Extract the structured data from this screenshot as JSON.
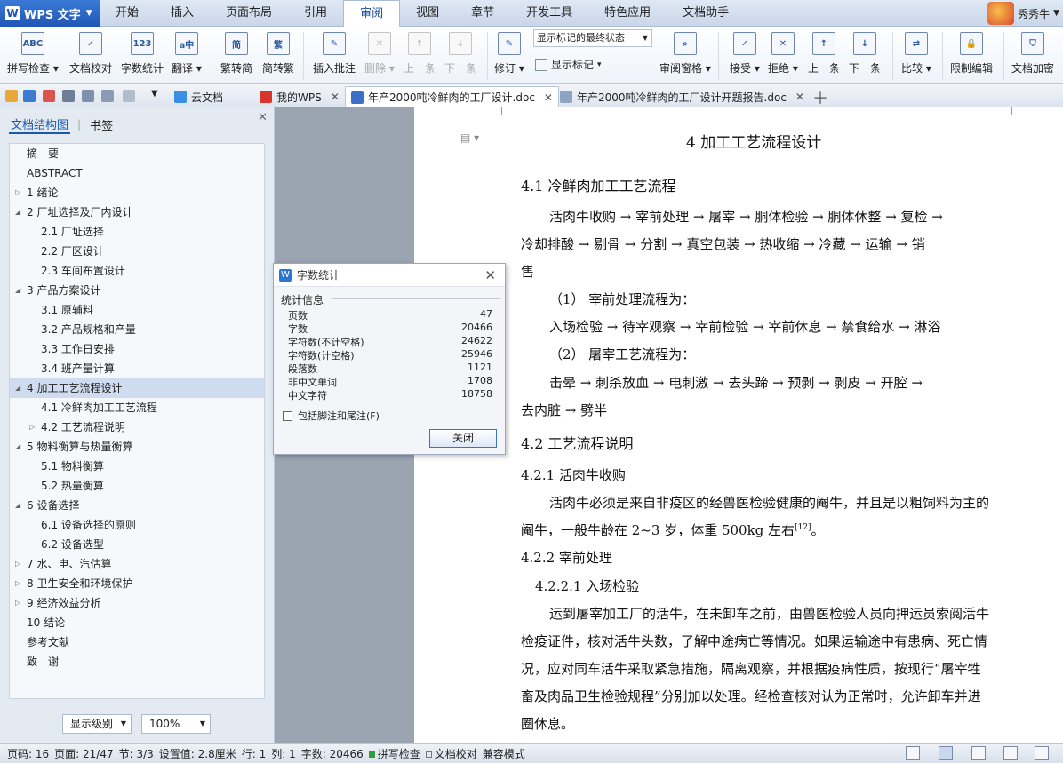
{
  "app": {
    "title": "WPS 文字"
  },
  "menu": [
    "开始",
    "插入",
    "页面布局",
    "引用",
    "审阅",
    "视图",
    "章节",
    "开发工具",
    "特色应用",
    "文档助手"
  ],
  "active_menu": "审阅",
  "user": {
    "name": "秀秀牛"
  },
  "ribbon": {
    "spell": "拼写检查",
    "doccheck": "文档校对",
    "wordcount": "字数统计",
    "translate": "翻译",
    "t2s": "繁转简",
    "s2t": "简转繁",
    "addcomment": "插入批注",
    "delete": "删除",
    "prev": "上一条",
    "next": "下一条",
    "revise": "修订",
    "markup_select": "显示标记的最终状态",
    "showmarks": "显示标记",
    "reviewpane": "审阅窗格",
    "accept": "接受",
    "reject": "拒绝",
    "prev2": "上一条",
    "next2": "下一条",
    "compare": "比较",
    "restrict": "限制编辑",
    "encrypt": "文档加密"
  },
  "tabs": [
    {
      "label": "云文档"
    },
    {
      "label": "我的WPS"
    },
    {
      "label": "年产2000吨冷鲜肉的工厂设计.doc"
    },
    {
      "label": "年产2000吨冷鲜肉的工厂设计开题报告.doc"
    }
  ],
  "panel": {
    "tab1": "文档结构图",
    "tab2": "书签",
    "level": "显示级别",
    "zoom": "100%"
  },
  "outline": [
    {
      "text": "摘　要",
      "lvl": 1,
      "tw": ""
    },
    {
      "text": "ABSTRACT",
      "lvl": 1,
      "tw": ""
    },
    {
      "text": "1  绪论",
      "lvl": 1,
      "tw": "▷"
    },
    {
      "text": "2  厂址选择及厂内设计",
      "lvl": 1,
      "tw": "◢"
    },
    {
      "text": "2.1  厂址选择",
      "lvl": 2,
      "tw": ""
    },
    {
      "text": "2.2  厂区设计",
      "lvl": 2,
      "tw": ""
    },
    {
      "text": "2.3  车间布置设计",
      "lvl": 2,
      "tw": ""
    },
    {
      "text": "3  产品方案设计",
      "lvl": 1,
      "tw": "◢"
    },
    {
      "text": "3.1  原辅料",
      "lvl": 2,
      "tw": ""
    },
    {
      "text": "3.2  产品规格和产量",
      "lvl": 2,
      "tw": ""
    },
    {
      "text": "3.3  工作日安排",
      "lvl": 2,
      "tw": ""
    },
    {
      "text": "3.4  班产量计算",
      "lvl": 2,
      "tw": ""
    },
    {
      "text": "4  加工工艺流程设计",
      "lvl": 1,
      "tw": "◢",
      "sel": true
    },
    {
      "text": "4.1  冷鲜肉加工工艺流程",
      "lvl": 2,
      "tw": ""
    },
    {
      "text": "4.2  工艺流程说明",
      "lvl": 2,
      "tw": "▷"
    },
    {
      "text": "5  物料衡算与热量衡算",
      "lvl": 1,
      "tw": "◢"
    },
    {
      "text": "5.1  物料衡算",
      "lvl": 2,
      "tw": ""
    },
    {
      "text": "5.2  热量衡算",
      "lvl": 2,
      "tw": ""
    },
    {
      "text": "6  设备选择",
      "lvl": 1,
      "tw": "◢"
    },
    {
      "text": "6.1  设备选择的原则",
      "lvl": 2,
      "tw": ""
    },
    {
      "text": "6.2  设备选型",
      "lvl": 2,
      "tw": ""
    },
    {
      "text": "7  水、电、汽估算",
      "lvl": 1,
      "tw": "▷"
    },
    {
      "text": "8  卫生安全和环境保护",
      "lvl": 1,
      "tw": "▷"
    },
    {
      "text": "9  经济效益分析",
      "lvl": 1,
      "tw": "▷"
    },
    {
      "text": "10  结论",
      "lvl": 1,
      "tw": ""
    },
    {
      "text": "参考文献",
      "lvl": 1,
      "tw": ""
    },
    {
      "text": "致　谢",
      "lvl": 1,
      "tw": ""
    }
  ],
  "doc": {
    "h1": "4  加工工艺流程设计",
    "h41": "4.1  冷鲜肉加工工艺流程",
    "p1a": "活肉牛收购 → 宰前处理 → 屠宰 → 胴体检验 → 胴体休整 → 复检 →",
    "p1b": "冷却排酸 → 剔骨 → 分割 → 真空包装 → 热收缩 → 冷藏 → 运输 → 销",
    "p1c": "售",
    "s1": "（1）  宰前处理流程为：",
    "s1f": "入场检验 → 待宰观察 → 宰前检验 → 宰前休息 → 禁食给水 → 淋浴",
    "s2": "（2）  屠宰工艺流程为：",
    "s2fa": "击晕 → 刺杀放血 → 电刺激 → 去头蹄 → 预剥 → 剥皮 → 开腔 →",
    "s2fb": "去内脏 → 劈半",
    "h42": "4.2  工艺流程说明",
    "h421": "4.2.1  活肉牛收购",
    "p2a": "活肉牛必须是来自非疫区的经兽医检验健康的阉牛，并且是以粗饲料为主的",
    "p2b": "阉牛，一般牛龄在 2~3 岁，体重 500kg 左右",
    "ref": "[12]",
    "p2end": "。",
    "h422": "4.2.2  宰前处理",
    "h4221": "4.2.2.1  入场检验",
    "p3a": "运到屠宰加工厂的活牛，在未卸车之前，由兽医检验人员向押运员索阅活牛",
    "p3b": "检疫证件，核对活牛头数，了解中途病亡等情况。如果运输途中有患病、死亡情",
    "p3c": "况，应对同车活牛采取紧急措施，隔离观察，并根据疫病性质，按现行“屠宰牲",
    "p3d": "畜及肉品卫生检验规程”分别加以处理。经检查核对认为正常时，允许卸车并进",
    "p3e": "圈休息。"
  },
  "dialog": {
    "title": "字数统计",
    "group": "统计信息",
    "stats": [
      [
        "页数",
        "47"
      ],
      [
        "字数",
        "20466"
      ],
      [
        "字符数(不计空格)",
        "24622"
      ],
      [
        "字符数(计空格)",
        "25946"
      ],
      [
        "段落数",
        "1121"
      ],
      [
        "非中文单词",
        "1708"
      ],
      [
        "中文字符",
        "18758"
      ]
    ],
    "checkbox": "包括脚注和尾注(F)",
    "close": "关闭"
  },
  "status": {
    "page_num": "页码: 16",
    "page": "页面: 21/47",
    "section": "节: 3/3",
    "setting": "设置值: 2.8厘米",
    "row": "行: 1",
    "col": "列: 1",
    "words": "字数: 20466",
    "spell": "拼写检查",
    "proof": "文档校对",
    "compat": "兼容模式"
  },
  "colors": {
    "accent": "#1f57b5",
    "spell_dot": "#2e9e3a"
  }
}
